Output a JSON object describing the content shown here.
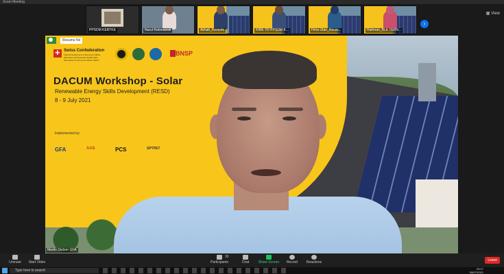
{
  "window": {
    "title": "Zoom Meeting"
  },
  "gallery": {
    "view_label": "View",
    "next_icon": "chevron-right-icon",
    "tiles": [
      {
        "name": "PPSDM KEBTKE"
      },
      {
        "name": "Nurul Rahmawati"
      },
      {
        "name": "Akhab_Kominfo"
      },
      {
        "name": "KIRE YD PPSDM K..."
      },
      {
        "name": "Fitria Utan_Recor..."
      },
      {
        "name": "Rahman_BLK TERN..."
      }
    ]
  },
  "slide": {
    "resume_label": "Resume Nir",
    "logos": {
      "swiss_title": "Swiss Confederation",
      "swiss_sub": "Federal Department of Economic Affairs, Education and Research EAER State Secretariat for Economic Affairs SECO",
      "bnsp": "BNSP"
    },
    "title": "DACUM Workshop - Solar",
    "subtitle": "Renewable Energy Skills Development (RESD)",
    "dates": "8 - 9 July 2021",
    "implemented_by": "Implemented by:",
    "partners": [
      "GFA",
      "AAS",
      "PCS",
      "SPTPET"
    ]
  },
  "speaker": {
    "name": "Martin Stotzer GFA"
  },
  "controls": {
    "unmute": "Unmute",
    "start_video": "Start Video",
    "participants": "Participants",
    "participants_count": "30",
    "chat": "Chat",
    "share_screen": "Share Screen",
    "record": "Record",
    "reactions": "Reactions",
    "leave": "Leave"
  },
  "taskbar": {
    "search_placeholder": "Type here to search",
    "time": "09:07",
    "date": "08/07/2021"
  },
  "colors": {
    "slide_yellow": "#f8c51a",
    "share_green": "#19c25a",
    "leave_red": "#e02828",
    "accent_blue": "#0e72ed"
  }
}
